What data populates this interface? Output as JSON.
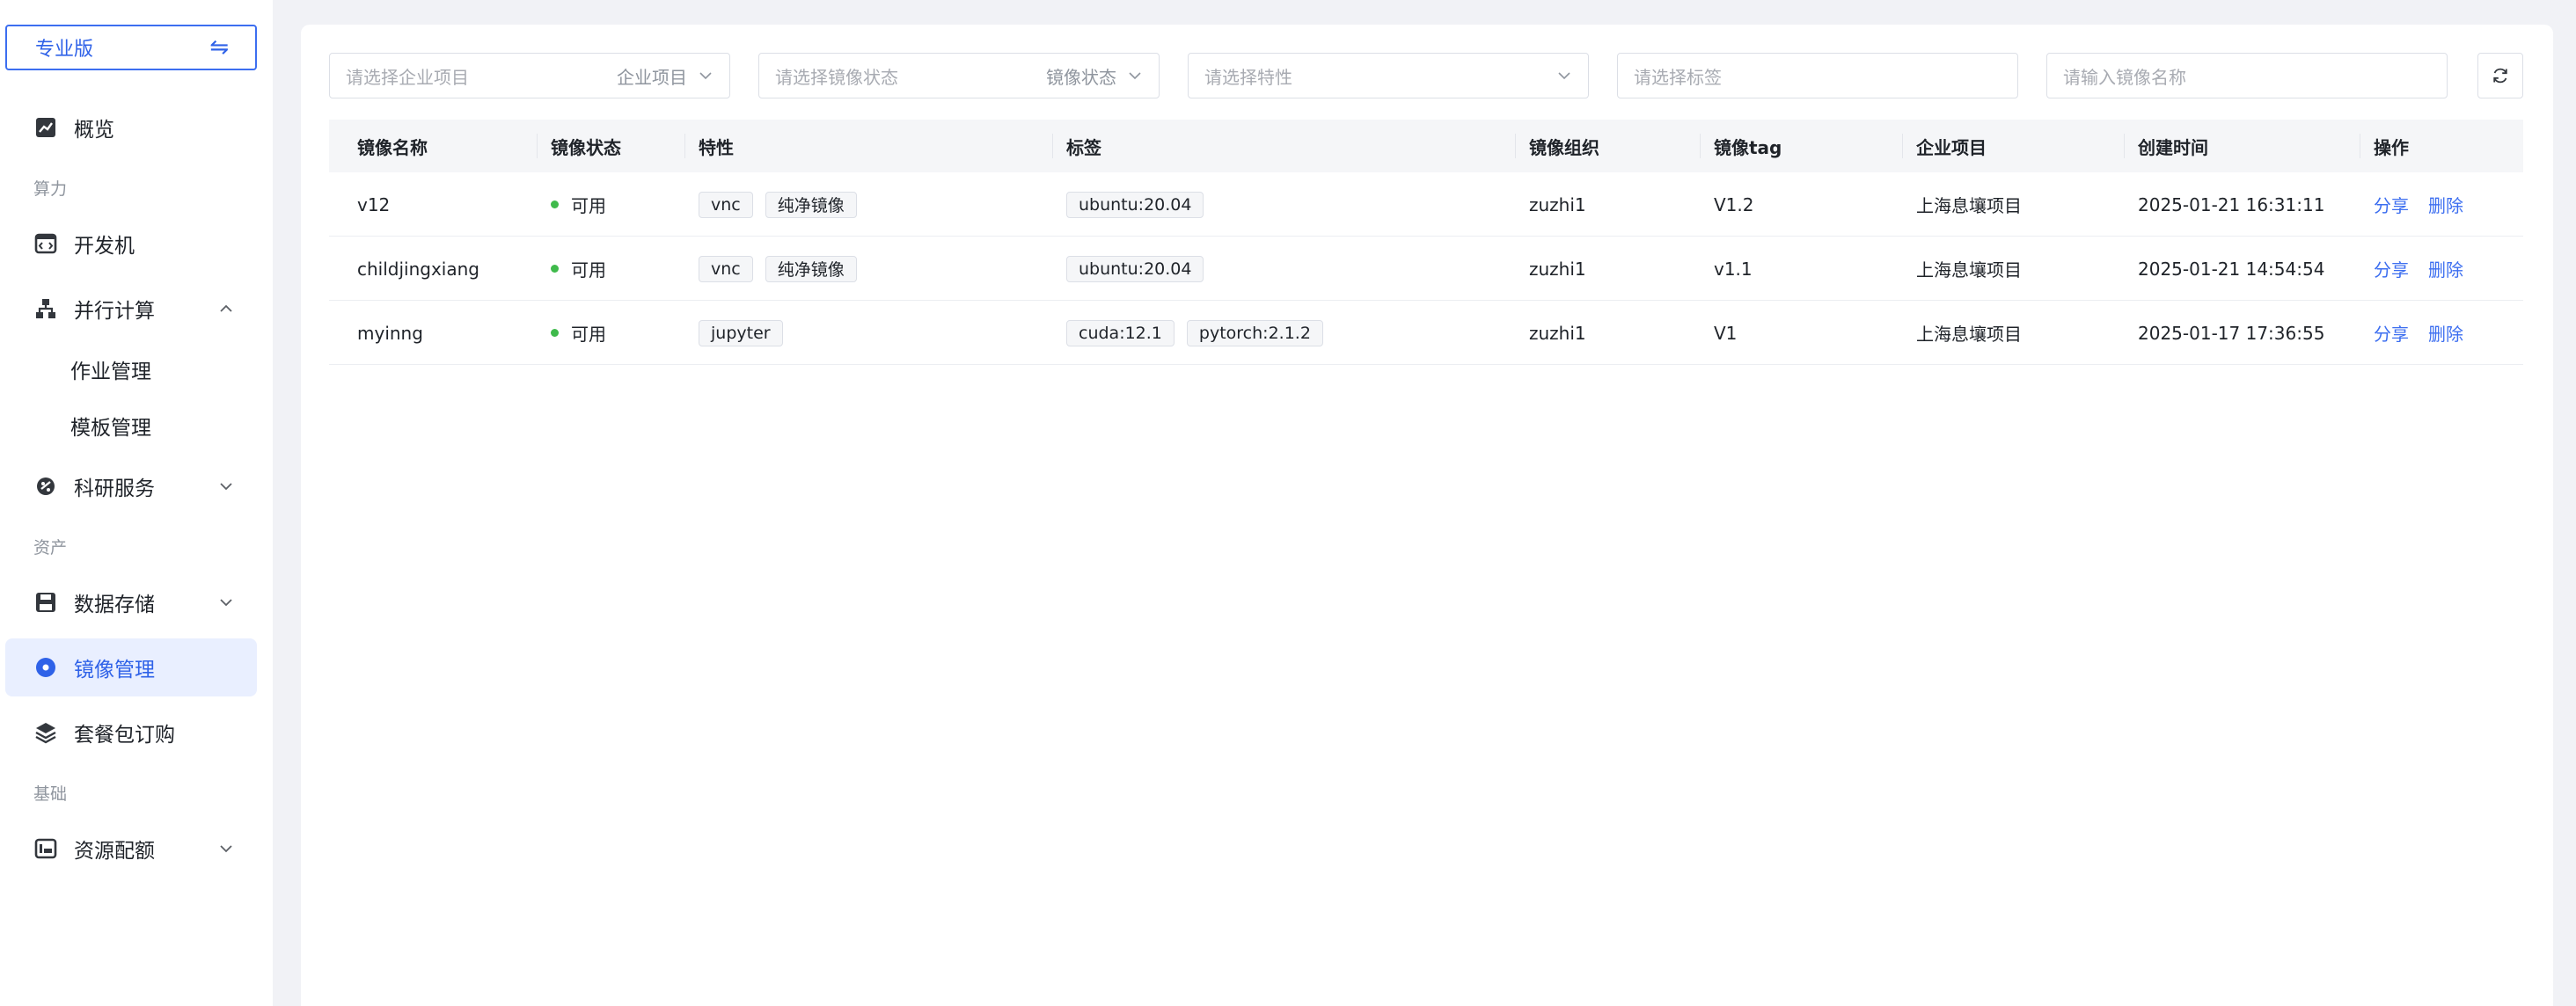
{
  "sidebar": {
    "edition_label": "专业版",
    "edition_switch_glyph": "⇋",
    "items": {
      "overview": "概览",
      "devbox": "开发机",
      "parallel": "并行计算",
      "jobs": "作业管理",
      "templates": "模板管理",
      "research": "科研服务",
      "storage": "数据存储",
      "images": "镜像管理",
      "packages": "套餐包订购",
      "quota": "资源配额"
    },
    "groups": {
      "compute": "算力",
      "assets": "资产",
      "basic": "基础"
    },
    "active_color": "#2f62e8"
  },
  "filters": {
    "project_placeholder": "请选择企业项目",
    "project_value": "企业项目",
    "status_placeholder": "请选择镜像状态",
    "status_value": "镜像状态",
    "feature_placeholder": "请选择特性",
    "tag_placeholder": "请选择标签",
    "name_placeholder": "请输入镜像名称"
  },
  "table": {
    "headers": {
      "name": "镜像名称",
      "status": "镜像状态",
      "feature": "特性",
      "tags": "标签",
      "org": "镜像组织",
      "tag": "镜像tag",
      "project": "企业项目",
      "created": "创建时间",
      "actions": "操作"
    },
    "action_share": "分享",
    "action_delete": "删除",
    "status_color": "#3fba4b",
    "rows": [
      {
        "name": "v12",
        "status": "可用",
        "features": [
          "vnc",
          "纯净镜像"
        ],
        "tags": [
          "ubuntu:20.04"
        ],
        "org": "zuzhi1",
        "tag": "V1.2",
        "project": "上海息壤项目",
        "created": "2025-01-21 16:31:11"
      },
      {
        "name": "childjingxiang",
        "status": "可用",
        "features": [
          "vnc",
          "纯净镜像"
        ],
        "tags": [
          "ubuntu:20.04"
        ],
        "org": "zuzhi1",
        "tag": "v1.1",
        "project": "上海息壤项目",
        "created": "2025-01-21 14:54:54"
      },
      {
        "name": "myinng",
        "status": "可用",
        "features": [
          "jupyter"
        ],
        "tags": [
          "cuda:12.1",
          "pytorch:2.1.2"
        ],
        "org": "zuzhi1",
        "tag": "V1",
        "project": "上海息壤项目",
        "created": "2025-01-17 17:36:55"
      }
    ]
  }
}
